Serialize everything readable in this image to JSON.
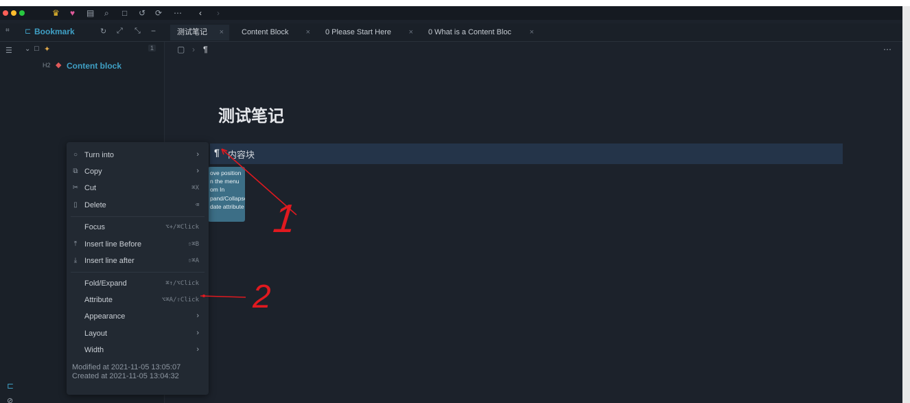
{
  "toolbar": {
    "icons": [
      "crown-icon",
      "heart-icon",
      "calendar-icon",
      "search-icon",
      "square-icon",
      "history-icon",
      "sync-icon",
      "more-icon",
      "back-icon",
      "forward-icon"
    ]
  },
  "sidebar": {
    "panel_title": "Bookmark",
    "count": "1",
    "item": {
      "heading_level": "H2",
      "label": "Content block"
    }
  },
  "tabs": [
    {
      "label": "测试笔记",
      "active": true
    },
    {
      "label": "Content Block",
      "active": false
    },
    {
      "label": "0 Please Start Here",
      "active": false
    },
    {
      "label": "0 What is a Content Bloc",
      "active": false
    }
  ],
  "breadcrumb": {
    "para_symbol": "¶"
  },
  "document": {
    "title": "测试笔记",
    "block_symbol": "¶",
    "block_text": "内容块"
  },
  "tooltip_lines": [
    "ove position",
    "n the menu",
    "om In",
    "pand/Collapse",
    "date attribute"
  ],
  "menu": {
    "items": [
      {
        "label": "Turn into",
        "icon": "circle-icon",
        "arrow": true
      },
      {
        "label": "Copy",
        "icon": "copy-icon",
        "arrow": true
      },
      {
        "label": "Cut",
        "icon": "cut-icon",
        "shortcut": "⌘X"
      },
      {
        "label": "Delete",
        "icon": "trash-icon",
        "shortcut": "⌫"
      },
      {
        "label": "Focus",
        "shortcut": "⌥+/⌘Click"
      },
      {
        "label": "Insert line Before",
        "icon": "insert-before-icon",
        "shortcut": "⇧⌘B"
      },
      {
        "label": "Insert line after",
        "icon": "insert-after-icon",
        "shortcut": "⇧⌘A"
      },
      {
        "label": "Fold/Expand",
        "shortcut": "⌘↑/⌥Click"
      },
      {
        "label": "Attribute",
        "shortcut": "⌥⌘A/⇧Click"
      },
      {
        "label": "Appearance",
        "arrow": true
      },
      {
        "label": "Layout",
        "arrow": true
      },
      {
        "label": "Width",
        "arrow": true
      }
    ],
    "modified": "Modified at 2021-11-05 13:05:07",
    "created": "Created at 2021-11-05 13:04:32"
  },
  "annotations": [
    "1",
    "2"
  ],
  "colors": {
    "accent": "#3fa0c5",
    "window_dot_red": "#ff5f57",
    "window_dot_yellow": "#febc2e",
    "window_dot_green": "#28c840",
    "annotation_red": "#e0191f",
    "block_highlight": "#243449",
    "tooltip": "#3c6e86"
  }
}
